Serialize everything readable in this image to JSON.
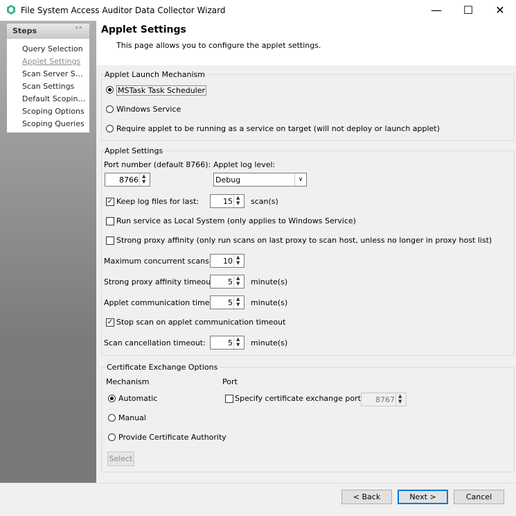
{
  "window": {
    "title": "File System Access Auditor Data Collector Wizard",
    "minimize": "—",
    "maximize": "☐",
    "close": "✕"
  },
  "sidebar": {
    "header": "Steps",
    "steps": [
      "Query Selection",
      "Applet Settings",
      "Scan Server Sel...",
      "Scan Settings",
      "Default Scoping...",
      "Scoping Options",
      "Scoping Queries"
    ],
    "active_index": 1
  },
  "header": {
    "title": "Applet Settings",
    "description": "This page allows you to configure the applet settings."
  },
  "launch": {
    "legend": "Applet Launch Mechanism",
    "options": [
      "MSTask Task Scheduler",
      "Windows Service",
      "Require applet to be running as a service on target (will not deploy or launch applet)"
    ],
    "selected": 0
  },
  "applet": {
    "legend": "Applet Settings",
    "port_label": "Port number (default 8766):",
    "port_value": "8766",
    "log_level_label": "Applet log level:",
    "log_level_value": "Debug",
    "keep_logs_label": "Keep log files for last:",
    "keep_logs_value": "15",
    "keep_logs_unit": "scan(s)",
    "keep_logs_checked": true,
    "local_system_label": "Run service as Local System (only applies to Windows Service)",
    "strong_affinity_label": "Strong proxy affinity (only run scans on last proxy to scan host, unless no longer in proxy host list)",
    "max_scans_label": "Maximum concurrent scans:",
    "max_scans_value": "10",
    "affinity_timeout_label": "Strong proxy affinity timeout:",
    "affinity_timeout_value": "5",
    "comm_timeout_label": "Applet communication timeout:",
    "comm_timeout_value": "5",
    "stop_scan_label": "Stop scan on applet communication timeout",
    "stop_scan_checked": true,
    "cancel_timeout_label": "Scan cancellation timeout:",
    "cancel_timeout_value": "5",
    "minute_unit": "minute(s)"
  },
  "cert": {
    "legend": "Certificate Exchange Options",
    "mechanism_label": "Mechanism",
    "port_label": "Port",
    "options": [
      "Automatic",
      "Manual",
      "Provide Certificate Authority"
    ],
    "selected": 0,
    "specify_port_label": "Specify certificate exchange port :",
    "port_value": "8767",
    "select_button": "Select"
  },
  "footer": {
    "back": "< Back",
    "next": "Next >",
    "cancel": "Cancel"
  }
}
